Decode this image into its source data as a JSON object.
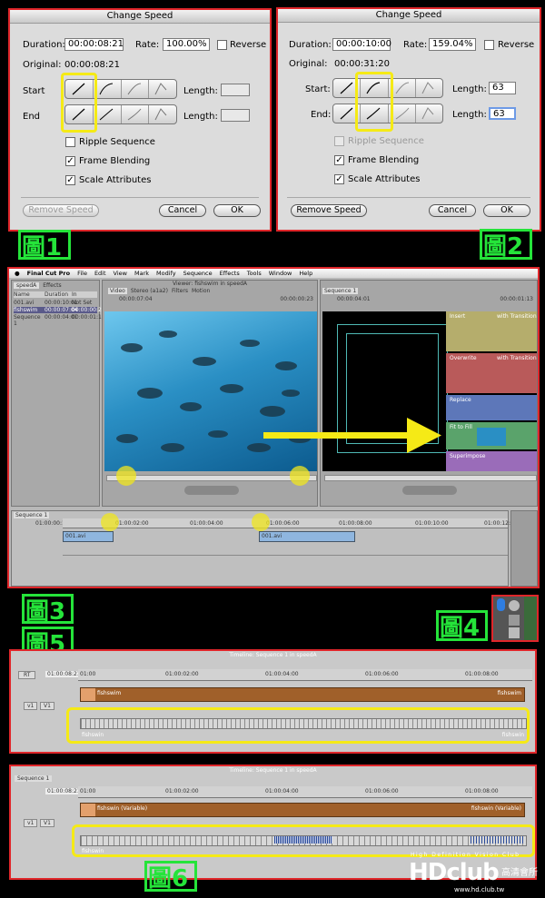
{
  "dialog1": {
    "title": "Change Speed",
    "duration_label": "Duration:",
    "duration_value": "00:00:08:21",
    "rate_label": "Rate:",
    "rate_value": "100.00%",
    "reverse_label": "Reverse",
    "original_label": "Original:",
    "original_value": "00:00:08:21",
    "start_label": "Start",
    "end_label": "End",
    "length_label": "Length:",
    "start_length": "",
    "end_length": "",
    "ripple_label": "Ripple Sequence",
    "frame_blending_label": "Frame Blending",
    "scale_label": "Scale Attributes",
    "remove_speed": "Remove Speed",
    "cancel": "Cancel",
    "ok": "OK"
  },
  "dialog2": {
    "title": "Change Speed",
    "duration_label": "Duration:",
    "duration_value": "00:00:10:00",
    "rate_label": "Rate:",
    "rate_value": "159.04%",
    "reverse_label": "Reverse",
    "original_label": "Original:",
    "original_value": "00:00:31:20",
    "start_label": "Start:",
    "end_label": "End:",
    "length_label": "Length:",
    "start_length": "63",
    "end_length": "63",
    "ripple_label": "Ripple Sequence",
    "frame_blending_label": "Frame Blending",
    "scale_label": "Scale Attributes",
    "remove_speed": "Remove Speed",
    "cancel": "Cancel",
    "ok": "OK"
  },
  "figures": {
    "f1": "圖1",
    "f2": "圖2",
    "f3": "圖3",
    "f4": "圖4",
    "f5": "圖5",
    "f6": "圖6"
  },
  "fcp": {
    "menu": [
      "Final Cut Pro",
      "File",
      "Edit",
      "View",
      "Mark",
      "Modify",
      "Sequence",
      "Effects",
      "Tools",
      "Window",
      "Help"
    ],
    "browser_tabs": [
      "speedA",
      "Effects"
    ],
    "browser_cols": [
      "Name",
      "Duration",
      "In"
    ],
    "browser_rows": [
      [
        "001.avi",
        "00:00:10:01",
        "Not Set"
      ],
      [
        "fishswim",
        "00:00:07:04",
        "00:00:00:23"
      ],
      [
        "Sequence 1",
        "00:00:04:01",
        "00:00:01:18"
      ]
    ],
    "viewer_title": "Viewer: fishswim in speedA",
    "viewer_tabs": [
      "Video",
      "Stereo (a1a2)",
      "Filters",
      "Motion"
    ],
    "viewer_tc_left": "00:00:07:04",
    "viewer_tc_right": "00:00:00:23",
    "canvas_tab": "Sequence 1",
    "canvas_tc_left": "00:00:04:01",
    "canvas_tc_right": "00:00:01:13",
    "overlay_cells": [
      "Insert",
      "with Transition",
      "Overwrite",
      "with Transition",
      "Replace",
      "Fit to Fill",
      "Superimpose"
    ],
    "timeline_tab": "Sequence 1",
    "timeline_tc": "01:00:00:13",
    "timeline_ruler": [
      "01:00:02:00",
      "01:00:04:00",
      "01:00:06:00",
      "01:00:08:00",
      "01:00:10:00",
      "01:00:12:00"
    ],
    "clip1": "001.avi",
    "clip2": "001.avi"
  },
  "tl5": {
    "title": "Timeline: Sequence 1 in speedA",
    "rt": "RT",
    "tc": "01:00:08:21",
    "ruler": [
      "01:00",
      "01:00:02:00",
      "01:00:04:00",
      "01:00:06:00",
      "01:00:08:00"
    ],
    "v_label": "v1",
    "V_label": "V1",
    "clip_left": "fishswim",
    "clip_right": "fishswim",
    "speed_label": "fishswin",
    "speed_label_right": "fishswin"
  },
  "tl6": {
    "tab": "Sequence 1",
    "title": "Timeline: Sequence 1 in speedA",
    "tc": "01:00:08:21",
    "ruler": [
      "01:00",
      "01:00:02:00",
      "01:00:04:00",
      "01:00:06:00",
      "01:00:08:00"
    ],
    "v_label": "v1",
    "V_label": "V1",
    "clip_left": "fishswin (Variable)",
    "clip_right": "fishswin (Variable)",
    "speed_label": "fishswin"
  },
  "watermark": {
    "tagline": "High Definition Vision Club",
    "logo": "HDclub",
    "cn": "高清會所",
    "url": "www.hd.club.tw"
  },
  "colors": {
    "frame_red": "#e0262a",
    "highlight_yellow": "#f5ea16",
    "fig_green": "#25e43a",
    "video_clip": "#8fb6df",
    "fishswim_clip": "#a0602a"
  }
}
